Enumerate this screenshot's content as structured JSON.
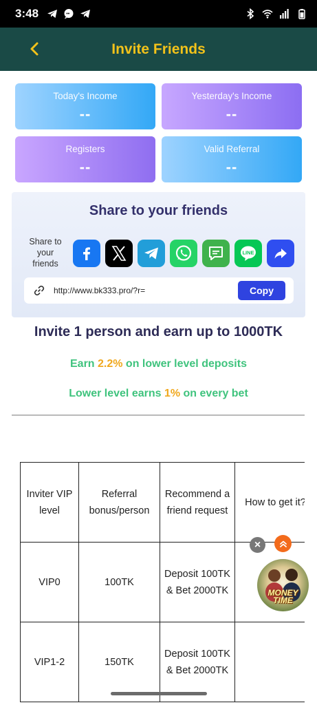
{
  "statusbar": {
    "time": "3:48"
  },
  "header": {
    "title": "Invite Friends"
  },
  "stats": [
    {
      "label": "Today's Income",
      "value": "--"
    },
    {
      "label": "Yesterday's Income",
      "value": "--"
    },
    {
      "label": "Registers",
      "value": "--"
    },
    {
      "label": "Valid Referral",
      "value": "--"
    }
  ],
  "share": {
    "title": "Share to your friends",
    "share_to": "Share to your friends",
    "link": "http://www.bk333.pro/?r=",
    "copy_label": "Copy",
    "platforms": [
      "facebook",
      "x",
      "telegram",
      "whatsapp",
      "sms",
      "line",
      "share"
    ]
  },
  "invite": {
    "headline": "Invite 1 person and earn up to 1000TK",
    "earn_deposit_pre": "Earn ",
    "earn_deposit_pct": "2.2%",
    "earn_deposit_post": " on lower level deposits",
    "earn_bet_pre": "Lower level earns ",
    "earn_bet_pct": "1%",
    "earn_bet_post": " on every bet"
  },
  "table": {
    "headers": [
      "Inviter VIP level",
      "Referral bonus/person",
      "Recommend a friend request",
      "How to get it?"
    ],
    "rows": [
      [
        "VIP0",
        "100TK",
        "Deposit 100TK & Bet 2000TK",
        ""
      ],
      [
        "VIP1-2",
        "150TK",
        "Deposit 100TK & Bet 2000TK",
        ""
      ]
    ]
  },
  "floating": {
    "close": "×",
    "game_label": "MONEY TIME"
  },
  "colors": {
    "header_bg": "#1a4a46",
    "title": "#f3c21a",
    "copy_btn": "#2f43e0",
    "earn": "#3fc37d",
    "highlight": "#f0a81e"
  }
}
